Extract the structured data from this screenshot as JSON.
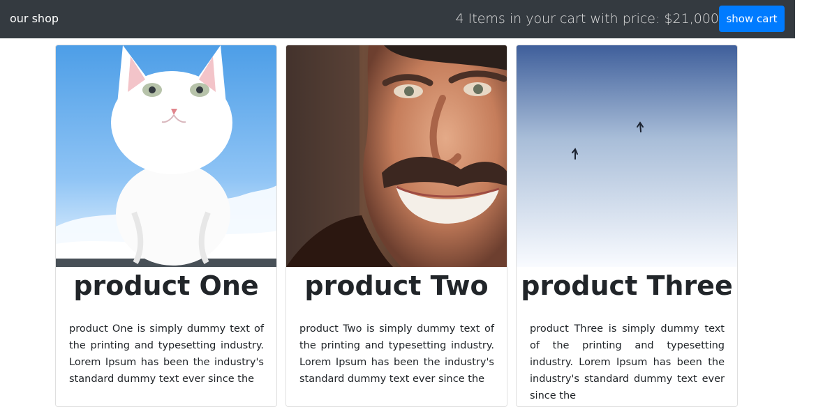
{
  "navbar": {
    "brand": "our shop",
    "cart_summary": "4 Items in your cart with price: $21,000",
    "cart_button_label": "show cart"
  },
  "products": [
    {
      "title": "product One",
      "description": "product One is simply dummy text of the printing and typesetting industry. Lorem Ipsum has been the industry's standard dummy text ever since the",
      "image": "kitten-photo"
    },
    {
      "title": "product Two",
      "description": "product Two is simply dummy text of the printing and typesetting industry. Lorem Ipsum has been the industry's standard dummy text ever since the",
      "image": "smiling-man-photo"
    },
    {
      "title": "product Three",
      "description": "product Three is simply dummy text of the printing and typesetting industry. Lorem Ipsum has been the industry's standard dummy text ever since the",
      "image": "sky-birds-photo"
    }
  ],
  "colors": {
    "navbar": "#343a40",
    "button": "#007bff",
    "text": "#212529"
  }
}
